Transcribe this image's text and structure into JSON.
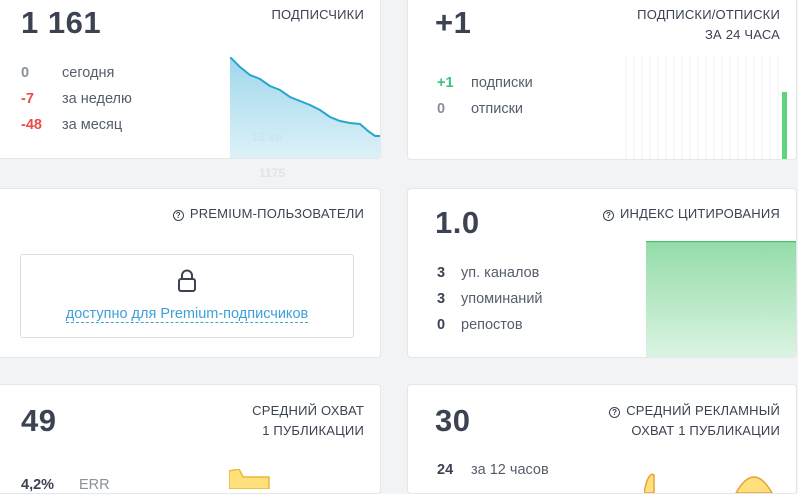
{
  "subscribers": {
    "count": "1 161",
    "title": "ПОДПИСЧИКИ",
    "rows": [
      {
        "value": "0",
        "label": "сегодня"
      },
      {
        "value": "-7",
        "label": "за неделю"
      },
      {
        "value": "-48",
        "label": "за месяц"
      }
    ],
    "tooltip_date": "12 ки",
    "tooltip_value": "1175"
  },
  "daily": {
    "count": "+1",
    "title_line1": "ПОДПИСКИ/ОТПИСКИ",
    "title_line2": "ЗА 24 ЧАСА",
    "rows": [
      {
        "value": "+1",
        "label": "подписки"
      },
      {
        "value": "0",
        "label": "отписки"
      }
    ]
  },
  "premium": {
    "title": "PREMIUM-ПОЛЬЗОВАТЕЛИ",
    "link": "доступно для Premium-подписчиков"
  },
  "citation": {
    "value": "1.0",
    "title": "ИНДЕКС ЦИТИРОВАНИЯ",
    "rows": [
      {
        "value": "3",
        "label": "уп. каналов"
      },
      {
        "value": "3",
        "label": "упоминаний"
      },
      {
        "value": "0",
        "label": "репостов"
      }
    ]
  },
  "reach": {
    "value": "49",
    "title_line1": "СРЕДНИЙ ОХВАТ",
    "title_line2": "1 ПУБЛИКАЦИИ",
    "err_value": "4,2%",
    "err_label": "ERR"
  },
  "ad_reach": {
    "value": "30",
    "title_line1": "СРЕДНИЙ РЕКЛАМНЫЙ",
    "title_line2": "ОХВАТ 1 ПУБЛИКАЦИИ",
    "row_value": "24",
    "row_label": "за 12 часов"
  },
  "colors": {
    "accent_blue": "#3f9fd8",
    "negative": "#e94a4a",
    "positive": "#3bbf7f"
  }
}
